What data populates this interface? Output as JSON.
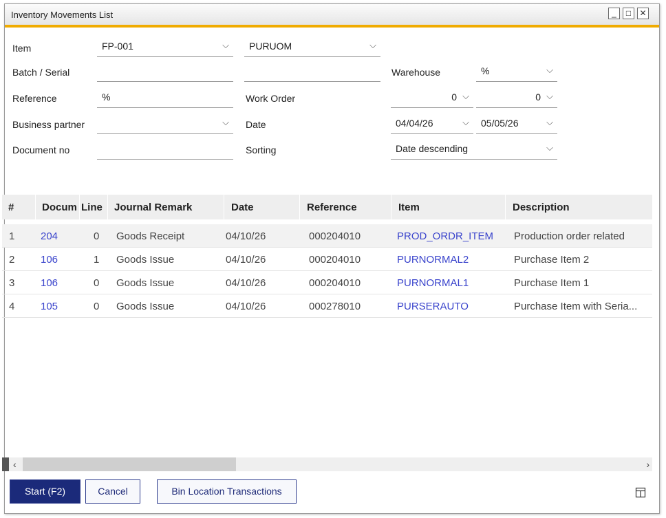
{
  "window": {
    "title": "Inventory Movements List"
  },
  "titlebar_buttons": {
    "minimize": "_",
    "maximize": "□",
    "close": "✕"
  },
  "filters": {
    "item_label": "Item",
    "item_value": "FP-001",
    "uom_value": "PURUOM",
    "batch_label": "Batch / Serial",
    "batch_value": "",
    "batch_value2": "",
    "warehouse_label": "Warehouse",
    "warehouse_value": "%",
    "reference_label": "Reference",
    "reference_value": "%",
    "work_order_label": "Work Order",
    "work_order_from": "0",
    "work_order_to": "0",
    "bp_label": "Business partner",
    "bp_value": "",
    "date_label": "Date",
    "date_from": "04/04/26",
    "date_to": "05/05/26",
    "docno_label": "Document no",
    "docno_value": "",
    "sorting_label": "Sorting",
    "sorting_value": "Date descending"
  },
  "grid": {
    "headers": [
      "#",
      "Docum",
      "Line",
      "Journal Remark",
      "Date",
      "Reference",
      "Item",
      "Description"
    ],
    "rows": [
      {
        "n": "1",
        "doc": "204",
        "line": "0",
        "remark": "Goods Receipt",
        "date": "04/10/26",
        "ref": "000204010",
        "item": "PROD_ORDR_ITEM",
        "desc": "Production order related"
      },
      {
        "n": "2",
        "doc": "106",
        "line": "1",
        "remark": "Goods Issue",
        "date": "04/10/26",
        "ref": "000204010",
        "item": "PURNORMAL2",
        "desc": "Purchase Item 2"
      },
      {
        "n": "3",
        "doc": "106",
        "line": "0",
        "remark": "Goods Issue",
        "date": "04/10/26",
        "ref": "000204010",
        "item": "PURNORMAL1",
        "desc": "Purchase Item 1"
      },
      {
        "n": "4",
        "doc": "105",
        "line": "0",
        "remark": "Goods Issue",
        "date": "04/10/26",
        "ref": "000278010",
        "item": "PURSERAUTO",
        "desc": "Purchase Item with Seria..."
      }
    ]
  },
  "scroll": {
    "left": "‹",
    "right": "›"
  },
  "buttons": {
    "start": "Start (F2)",
    "cancel": "Cancel",
    "bin": "Bin Location Transactions"
  },
  "colors": {
    "accent": "#f0ab00",
    "primary": "#1b2a7a",
    "link": "#3a44cc"
  }
}
